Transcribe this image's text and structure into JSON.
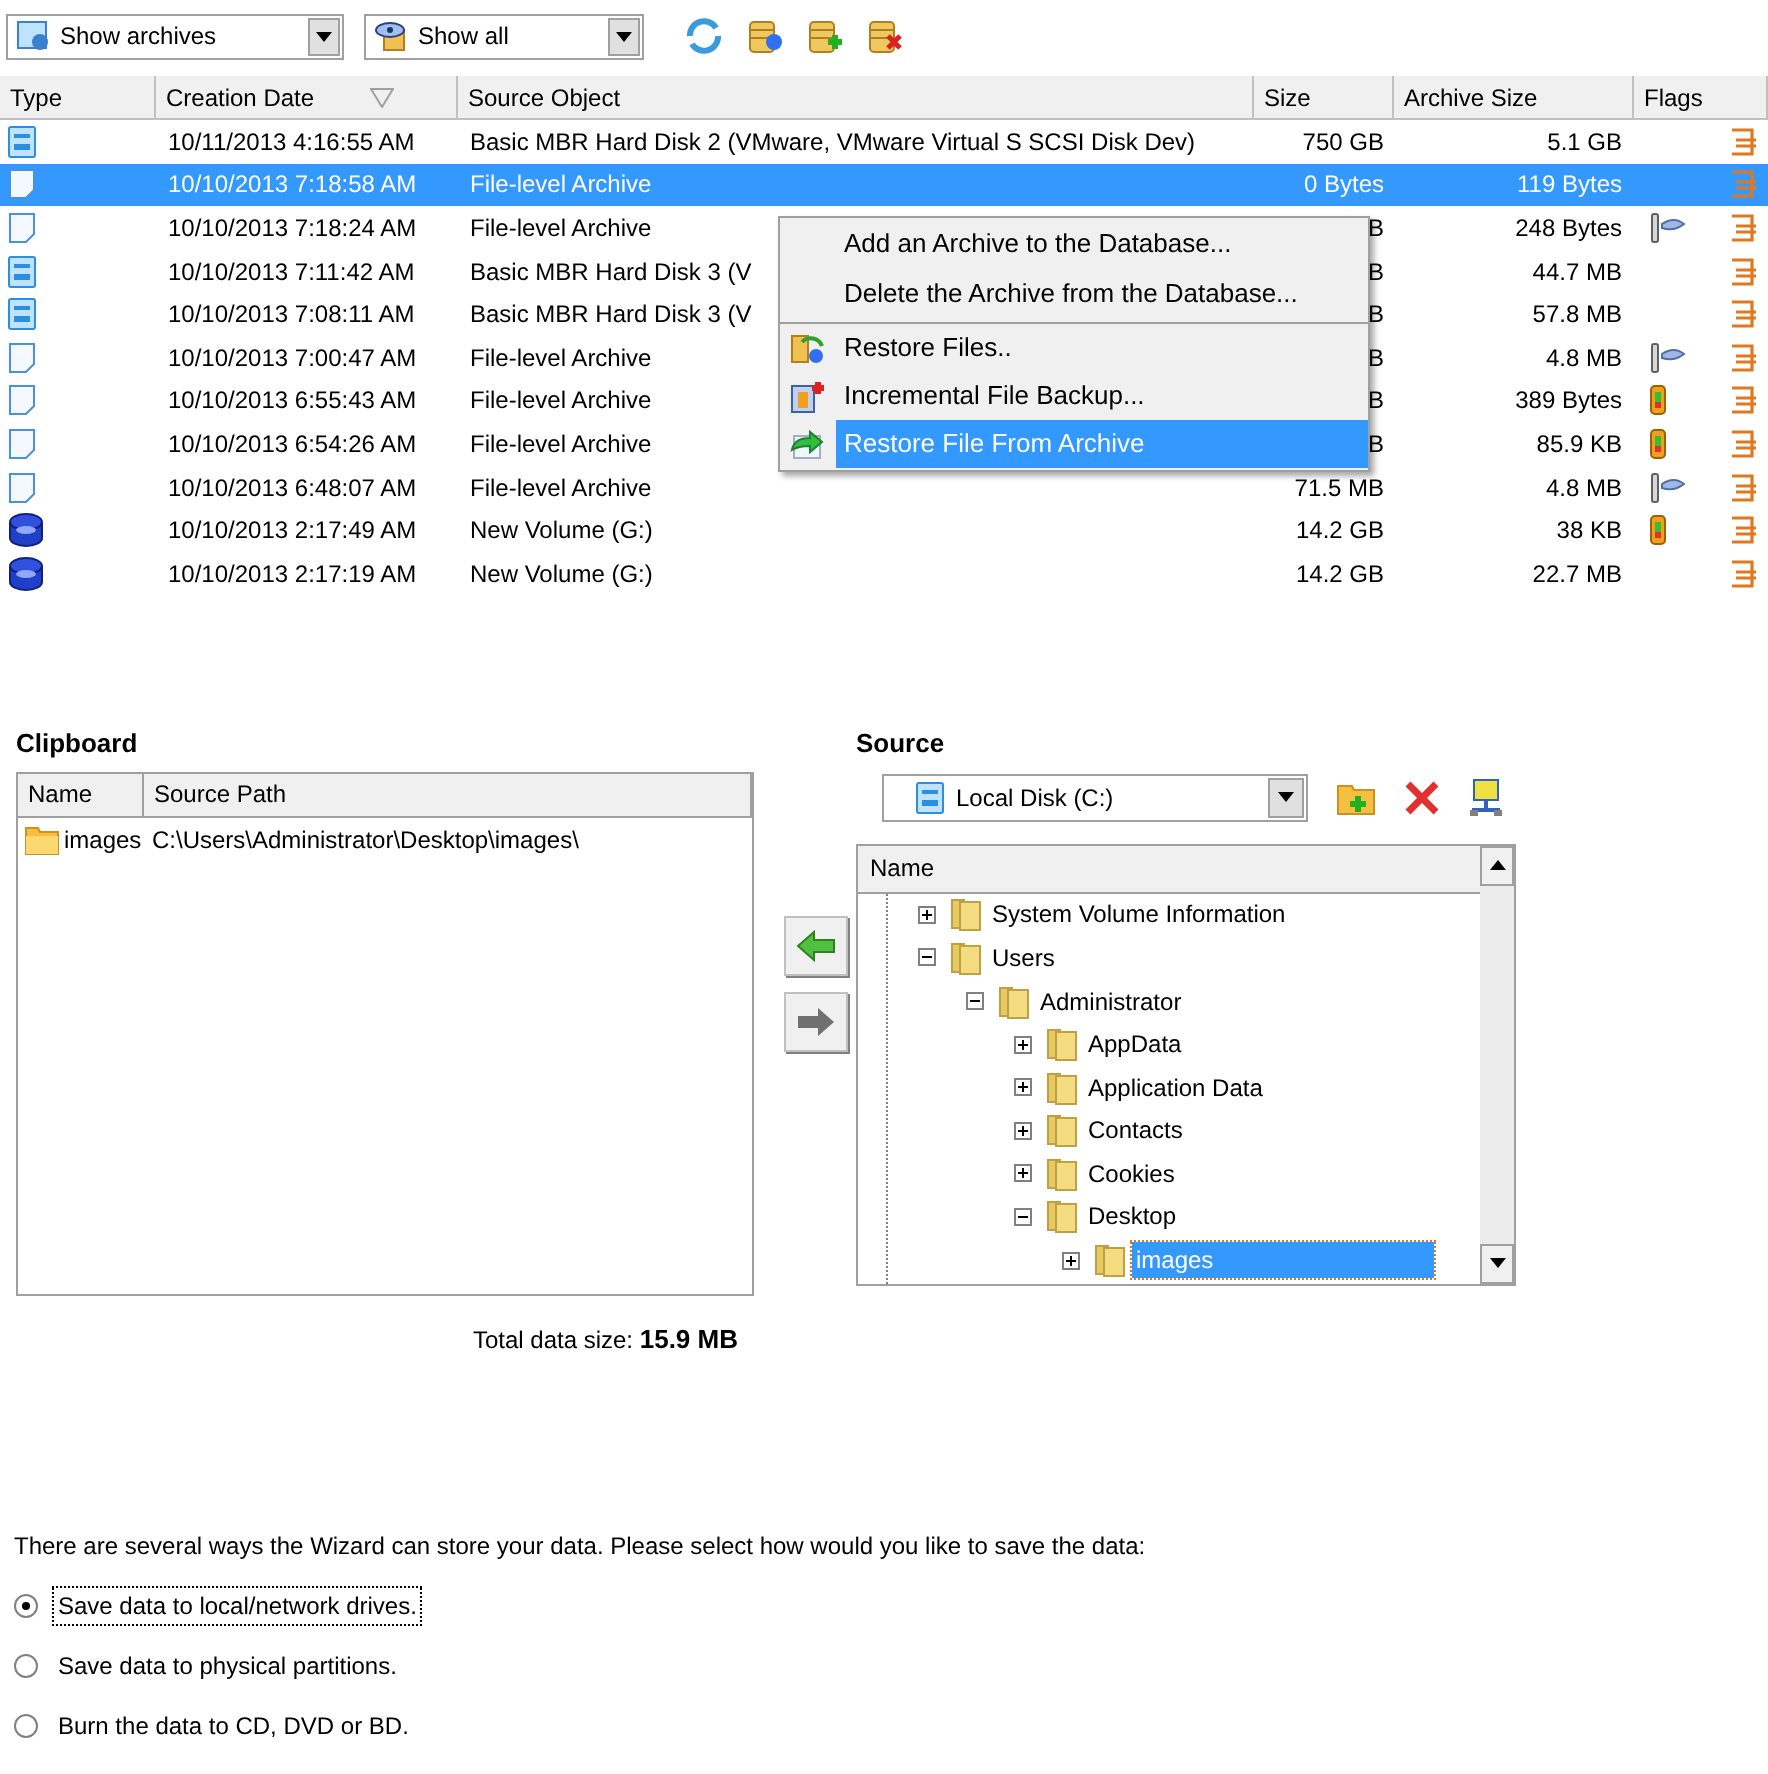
{
  "toolbar": {
    "view_dropdown": {
      "value": "Show archives"
    },
    "filter_dropdown": {
      "value": "Show all"
    }
  },
  "archives": {
    "columns": [
      "Type",
      "Creation Date",
      "Source Object",
      "Size",
      "Archive Size",
      "Flags"
    ],
    "rows": [
      {
        "kind": "disk",
        "date": "10/11/2013 4:16:55 AM",
        "source": "Basic MBR Hard Disk 2 (VMware, VMware Virtual S SCSI Disk Dev)",
        "size": "750 GB",
        "archive_size": "5.1 GB",
        "flags": [
          {
            "kind": "chain"
          }
        ],
        "selected": false
      },
      {
        "kind": "file",
        "date": "10/10/2013 7:18:58 AM",
        "source": "File-level Archive",
        "size": "0 Bytes",
        "archive_size": "119 Bytes",
        "flags": [
          {
            "kind": "chain"
          }
        ],
        "selected": true
      },
      {
        "kind": "file",
        "date": "10/10/2013 7:18:24 AM",
        "source": "File-level Archive",
        "size": "B",
        "archive_size": "248 Bytes",
        "flags": [
          {
            "kind": "key"
          },
          {
            "kind": "chain"
          }
        ],
        "selected": false
      },
      {
        "kind": "disk",
        "date": "10/10/2013 7:11:42 AM",
        "source": "Basic MBR Hard Disk 3 (V",
        "size": "B",
        "archive_size": "44.7 MB",
        "flags": [
          {
            "kind": "chain"
          }
        ],
        "selected": false
      },
      {
        "kind": "disk",
        "date": "10/10/2013 7:08:11 AM",
        "source": "Basic MBR Hard Disk 3 (V",
        "size": "B",
        "archive_size": "57.8 MB",
        "flags": [
          {
            "kind": "chain"
          }
        ],
        "selected": false
      },
      {
        "kind": "file",
        "date": "10/10/2013 7:00:47 AM",
        "source": "File-level Archive",
        "size": "B",
        "archive_size": "4.8 MB",
        "flags": [
          {
            "kind": "key"
          },
          {
            "kind": "chain"
          }
        ],
        "selected": false
      },
      {
        "kind": "file",
        "date": "10/10/2013 6:55:43 AM",
        "source": "File-level Archive",
        "size": "B",
        "archive_size": "389 Bytes",
        "flags": [
          {
            "kind": "battery"
          },
          {
            "kind": "chain"
          }
        ],
        "selected": false
      },
      {
        "kind": "file",
        "date": "10/10/2013 6:54:26 AM",
        "source": "File-level Archive",
        "size": "B",
        "archive_size": "85.9 KB",
        "flags": [
          {
            "kind": "battery"
          },
          {
            "kind": "chain"
          }
        ],
        "selected": false
      },
      {
        "kind": "file",
        "date": "10/10/2013 6:48:07 AM",
        "source": "File-level Archive",
        "size": "71.5 MB",
        "archive_size": "4.8 MB",
        "flags": [
          {
            "kind": "key"
          },
          {
            "kind": "chain"
          }
        ],
        "selected": false
      },
      {
        "kind": "volume",
        "date": "10/10/2013 2:17:49 AM",
        "source": "New Volume (G:)",
        "size": "14.2 GB",
        "archive_size": "38 KB",
        "flags": [
          {
            "kind": "battery"
          },
          {
            "kind": "chain"
          }
        ],
        "selected": false
      },
      {
        "kind": "volume",
        "date": "10/10/2013 2:17:19 AM",
        "source": "New Volume (G:)",
        "size": "14.2 GB",
        "archive_size": "22.7 MB",
        "flags": [
          {
            "kind": "chain"
          }
        ],
        "selected": false
      }
    ]
  },
  "context_menu": {
    "items": [
      {
        "label": "Add an Archive to the Database...",
        "kind": "plain",
        "selected": false,
        "separator_after": false
      },
      {
        "label": "Delete the Archive from the Database...",
        "kind": "plain",
        "selected": false,
        "separator_after": true
      },
      {
        "label": "Restore Files..",
        "kind": "restore",
        "selected": false,
        "separator_after": false
      },
      {
        "label": "Incremental File Backup...",
        "kind": "incremental",
        "selected": false,
        "separator_after": false
      },
      {
        "label": "Restore File From Archive",
        "kind": "arrow",
        "selected": true,
        "separator_after": false
      }
    ]
  },
  "clipboard": {
    "title": "Clipboard",
    "columns": [
      "Name",
      "Source Path"
    ],
    "rows": [
      {
        "name": "images",
        "path": "C:\\Users\\Administrator\\Desktop\\images\\"
      }
    ],
    "total_label": "Total data size:",
    "total_value": "15.9 MB"
  },
  "source": {
    "title": "Source",
    "drive_dropdown": {
      "value": "Local Disk (C:)"
    },
    "tree_header": "Name",
    "tree": [
      {
        "label": "System Volume Information",
        "expanded": false,
        "selected": false
      },
      {
        "label": "Users",
        "expanded": true,
        "selected": false,
        "children": [
          {
            "label": "Administrator",
            "expanded": true,
            "selected": false,
            "children": [
              {
                "label": "AppData",
                "expanded": false,
                "selected": false
              },
              {
                "label": "Application Data",
                "expanded": false,
                "selected": false
              },
              {
                "label": "Contacts",
                "expanded": false,
                "selected": false
              },
              {
                "label": "Cookies",
                "expanded": false,
                "selected": false
              },
              {
                "label": "Desktop",
                "expanded": true,
                "selected": false,
                "children": [
                  {
                    "label": "images",
                    "expanded": false,
                    "selected": true
                  }
                ]
              }
            ]
          }
        ]
      }
    ]
  },
  "storage": {
    "prompt": "There are several ways the Wizard can store your data. Please select how would you like to save the data:",
    "options": [
      {
        "label": "Save data to local/network drives.",
        "selected": true
      },
      {
        "label": "Save data to physical partitions.",
        "selected": false
      },
      {
        "label": "Burn the data to CD, DVD or BD.",
        "selected": false
      }
    ]
  }
}
